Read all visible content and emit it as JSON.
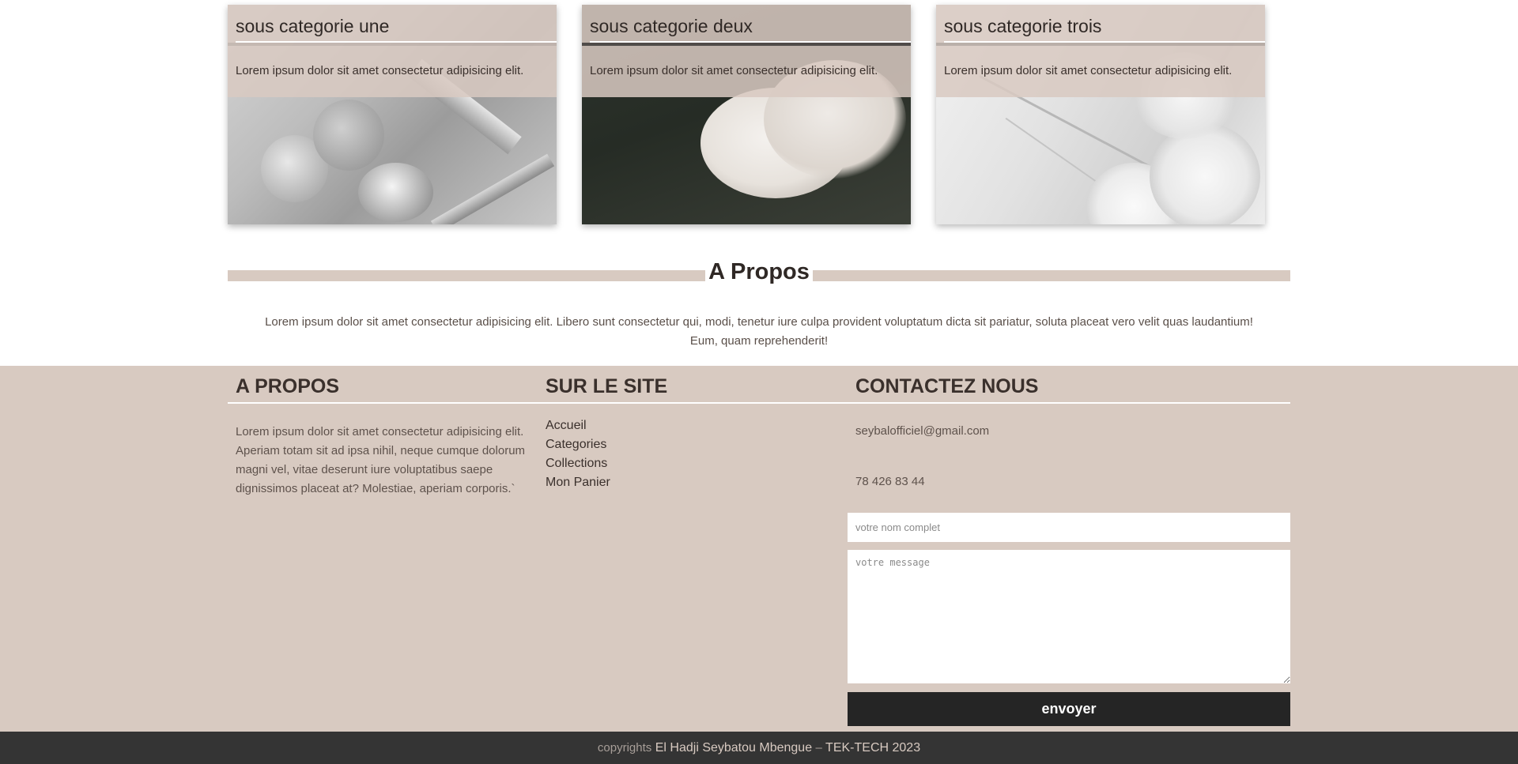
{
  "categories": [
    {
      "title": "sous categorie une",
      "description": "Lorem ipsum dolor sit amet consectetur adipisicing elit."
    },
    {
      "title": "sous categorie deux",
      "description": "Lorem ipsum dolor sit amet consectetur adipisicing elit."
    },
    {
      "title": "sous categorie trois",
      "description": "Lorem ipsum dolor sit amet consectetur adipisicing elit."
    }
  ],
  "apropos": {
    "title": "A Propos",
    "text": "Lorem ipsum dolor sit amet consectetur adipisicing elit. Libero sunt consectetur qui, modi, tenetur iure culpa provident voluptatum dicta sit pariatur, soluta placeat vero velit quas laudantium! Eum, quam reprehenderit!"
  },
  "footer": {
    "about": {
      "heading": "A PROPOS",
      "text": "Lorem ipsum dolor sit amet consectetur adipisicing elit. Aperiam totam sit ad ipsa nihil, neque cumque dolorum magni vel, vitae deserunt iure voluptatibus saepe dignissimos placeat at? Molestiae, aperiam corporis.`"
    },
    "site": {
      "heading": "SUR LE SITE",
      "links": [
        "Accueil",
        "Categories",
        "Collections",
        "Mon Panier"
      ]
    },
    "contact": {
      "heading": "CONTACTEZ NOUS",
      "email": "seybalofficiel@gmail.com",
      "phone": "78 426 83 44",
      "name_placeholder": "votre nom complet",
      "message_placeholder": "votre message",
      "send_label": "envoyer"
    }
  },
  "copyright": {
    "prefix": "copyrights",
    "author": "El Hadji Seybatou Mbengue",
    "separator": "–",
    "suffix": "TEK-TECH 2023"
  },
  "colors": {
    "accent_beige": "#d8cac1",
    "dark_footer": "#343434",
    "button": "#252525"
  }
}
